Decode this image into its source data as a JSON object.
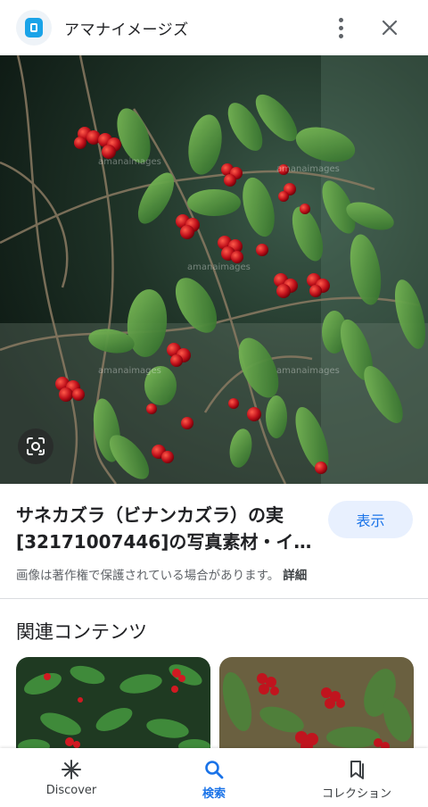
{
  "header": {
    "site_name": "アマナイメージズ",
    "logo_icon": "amana-images-logo",
    "more_icon": "more-vert-icon",
    "close_icon": "close-icon"
  },
  "image": {
    "watermark": "amanaimages",
    "lens_icon": "google-lens-icon"
  },
  "info": {
    "title_line1": "サネカズラ（ビナンカズラ）の実",
    "title_line2": "[32171007446]の写真素材・イ…",
    "view_button": "表示",
    "copyright_notice": "画像は著作権で保護されている場合があります。",
    "details_link": "詳細"
  },
  "related": {
    "heading": "関連コンテンツ"
  },
  "bottom_nav": {
    "items": [
      {
        "label": "Discover",
        "icon": "asterisk-icon",
        "active": false
      },
      {
        "label": "検索",
        "icon": "search-icon",
        "active": true
      },
      {
        "label": "コレクション",
        "icon": "bookmark-collection-icon",
        "active": false
      }
    ]
  },
  "colors": {
    "accent": "#1a73e8",
    "accent_bg": "#e8f0fe",
    "text_primary": "#202124",
    "text_secondary": "#5f6368"
  }
}
